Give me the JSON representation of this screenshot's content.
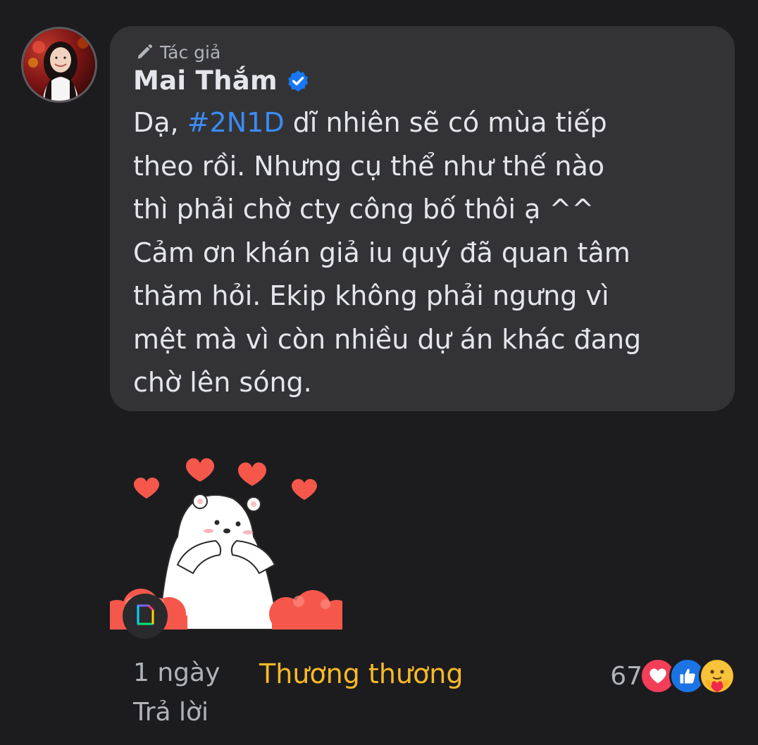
{
  "comment": {
    "author_badge": "Tác giả",
    "author_name": "Mai Thắm",
    "text_prefix": "Dạ, ",
    "hashtag": "#2N1D",
    "text_rest": " dĩ nhiên sẽ có mùa tiếp\ntheo rồi. Nhưng cụ thể như thế nào\nthì phải chờ cty công bố thôi ạ ^^\nCảm ơn khán giả iu quý đã quan tâm\nthăm hỏi. Ekip không phải ngưng vì\nmệt mà vì còn nhiều dự án khác đang\nchờ lên sóng."
  },
  "actions": {
    "time": "1 ngày",
    "reply": "Trả lời",
    "reaction_label": "Thương thương"
  },
  "reactions": {
    "count": "67",
    "types": [
      "love-icon",
      "like-icon",
      "care-icon"
    ]
  },
  "colors": {
    "background": "#1c1c1e",
    "bubble": "#333336",
    "hashtag": "#3b8cf5",
    "reaction_label": "#f7b928",
    "verified": "#1877f2"
  }
}
